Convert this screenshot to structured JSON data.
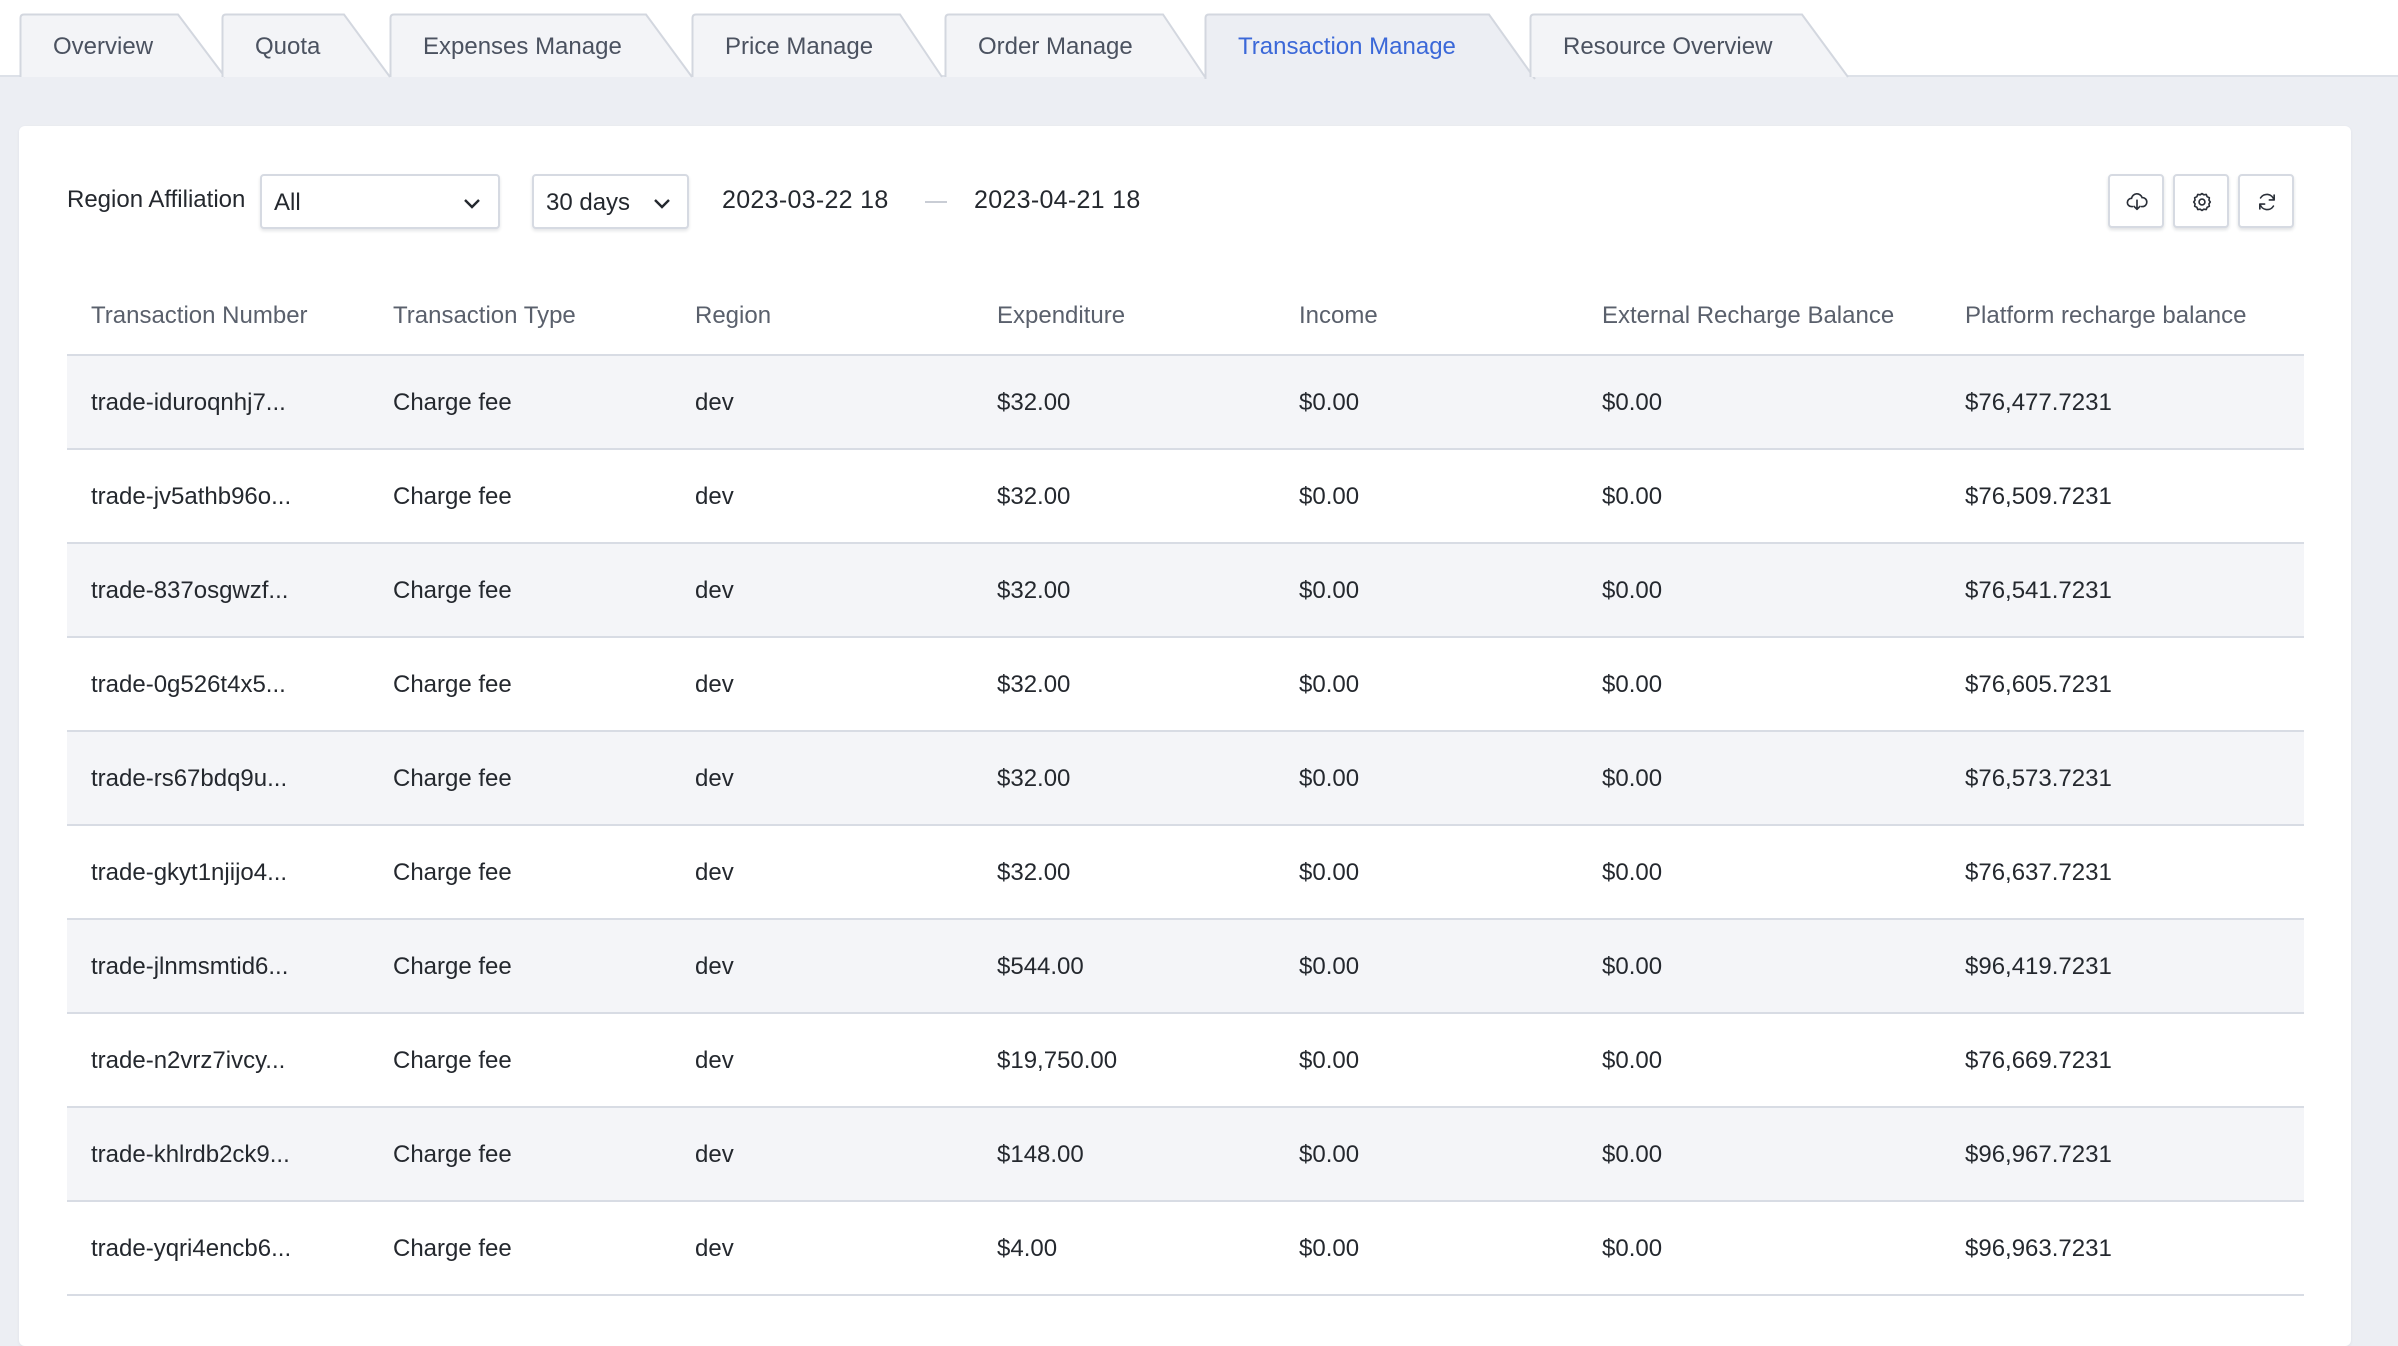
{
  "tabs": [
    {
      "label": "Overview",
      "active": false
    },
    {
      "label": "Quota",
      "active": false
    },
    {
      "label": "Expenses Manage",
      "active": false
    },
    {
      "label": "Price Manage",
      "active": false
    },
    {
      "label": "Order Manage",
      "active": false
    },
    {
      "label": "Transaction Manage",
      "active": true
    },
    {
      "label": "Resource Overview",
      "active": false
    }
  ],
  "filters": {
    "region_label": "Region Affiliation",
    "region_value": "All",
    "period_value": "30 days",
    "date_start": "2023-03-22 18",
    "date_end": "2023-04-21 18"
  },
  "toolbar": {
    "icons": [
      "cloud-download-icon",
      "settings-icon",
      "refresh-icon"
    ]
  },
  "table": {
    "columns": [
      "Transaction Number",
      "Transaction Type",
      "Region",
      "Expenditure",
      "Income",
      "External Recharge Balance",
      "Platform recharge balance"
    ],
    "rows": [
      [
        "trade-iduroqnhj7...",
        "Charge fee",
        "dev",
        "$32.00",
        "$0.00",
        "$0.00",
        "$76,477.7231"
      ],
      [
        "trade-jv5athb96o...",
        "Charge fee",
        "dev",
        "$32.00",
        "$0.00",
        "$0.00",
        "$76,509.7231"
      ],
      [
        "trade-837osgwzf...",
        "Charge fee",
        "dev",
        "$32.00",
        "$0.00",
        "$0.00",
        "$76,541.7231"
      ],
      [
        "trade-0g526t4x5...",
        "Charge fee",
        "dev",
        "$32.00",
        "$0.00",
        "$0.00",
        "$76,605.7231"
      ],
      [
        "trade-rs67bdq9u...",
        "Charge fee",
        "dev",
        "$32.00",
        "$0.00",
        "$0.00",
        "$76,573.7231"
      ],
      [
        "trade-gkyt1njijo4...",
        "Charge fee",
        "dev",
        "$32.00",
        "$0.00",
        "$0.00",
        "$76,637.7231"
      ],
      [
        "trade-jlnmsmtid6...",
        "Charge fee",
        "dev",
        "$544.00",
        "$0.00",
        "$0.00",
        "$96,419.7231"
      ],
      [
        "trade-n2vrz7ivcy...",
        "Charge fee",
        "dev",
        "$19,750.00",
        "$0.00",
        "$0.00",
        "$76,669.7231"
      ],
      [
        "trade-khlrdb2ck9...",
        "Charge fee",
        "dev",
        "$148.00",
        "$0.00",
        "$0.00",
        "$96,967.7231"
      ],
      [
        "trade-yqri4encb6...",
        "Charge fee",
        "dev",
        "$4.00",
        "$0.00",
        "$0.00",
        "$96,963.7231"
      ]
    ]
  },
  "colors": {
    "accent": "#3b68d8",
    "page_bg": "#eceef3",
    "row_stripe": "#f4f5f8"
  }
}
